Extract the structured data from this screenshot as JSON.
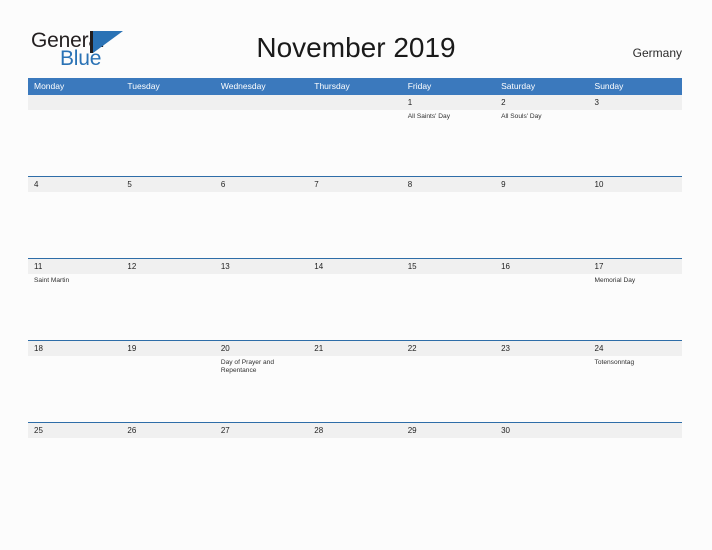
{
  "brand": {
    "name_part1": "General",
    "name_part2": "Blue",
    "triangle_icon": "triangle-right-icon",
    "color_dark": "#231f20",
    "color_blue": "#2a72b5"
  },
  "header": {
    "title": "November 2019",
    "country": "Germany",
    "header_bg": "#3b79bd",
    "row_band_bg": "#f0f0f0",
    "divider_color": "#2e6da8"
  },
  "weekdays": [
    "Monday",
    "Tuesday",
    "Wednesday",
    "Thursday",
    "Friday",
    "Saturday",
    "Sunday"
  ],
  "weeks": [
    {
      "days": [
        {
          "num": "",
          "events": []
        },
        {
          "num": "",
          "events": []
        },
        {
          "num": "",
          "events": []
        },
        {
          "num": "",
          "events": []
        },
        {
          "num": "1",
          "events": [
            "All Saints' Day"
          ]
        },
        {
          "num": "2",
          "events": [
            "All Souls' Day"
          ]
        },
        {
          "num": "3",
          "events": []
        }
      ]
    },
    {
      "days": [
        {
          "num": "4",
          "events": []
        },
        {
          "num": "5",
          "events": []
        },
        {
          "num": "6",
          "events": []
        },
        {
          "num": "7",
          "events": []
        },
        {
          "num": "8",
          "events": []
        },
        {
          "num": "9",
          "events": []
        },
        {
          "num": "10",
          "events": []
        }
      ]
    },
    {
      "days": [
        {
          "num": "11",
          "events": [
            "Saint Martin"
          ]
        },
        {
          "num": "12",
          "events": []
        },
        {
          "num": "13",
          "events": []
        },
        {
          "num": "14",
          "events": []
        },
        {
          "num": "15",
          "events": []
        },
        {
          "num": "16",
          "events": []
        },
        {
          "num": "17",
          "events": [
            "Memorial Day"
          ]
        }
      ]
    },
    {
      "days": [
        {
          "num": "18",
          "events": []
        },
        {
          "num": "19",
          "events": []
        },
        {
          "num": "20",
          "events": [
            "Day of Prayer and Repentance"
          ]
        },
        {
          "num": "21",
          "events": []
        },
        {
          "num": "22",
          "events": []
        },
        {
          "num": "23",
          "events": []
        },
        {
          "num": "24",
          "events": [
            "Totensonntag"
          ]
        }
      ]
    },
    {
      "days": [
        {
          "num": "25",
          "events": []
        },
        {
          "num": "26",
          "events": []
        },
        {
          "num": "27",
          "events": []
        },
        {
          "num": "28",
          "events": []
        },
        {
          "num": "29",
          "events": []
        },
        {
          "num": "30",
          "events": []
        },
        {
          "num": "",
          "events": []
        }
      ]
    }
  ]
}
